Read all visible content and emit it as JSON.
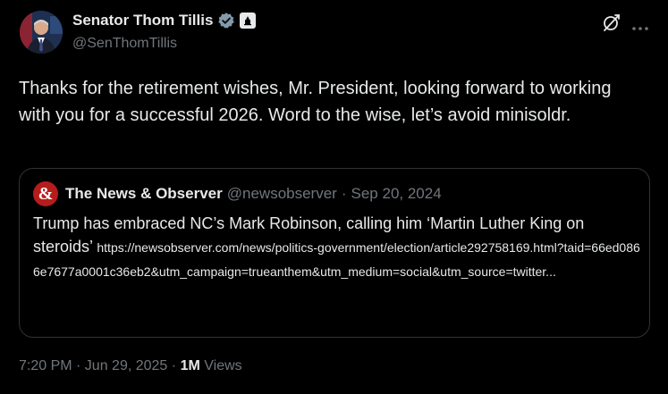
{
  "author": {
    "name": "Senator Thom Tillis",
    "handle": "@SenThomTillis",
    "avatar_icon": "portrait-avatar",
    "verified_icon": "verified-badge-icon",
    "gov_badge_icon": "us-capitol-badge-icon"
  },
  "top_actions": {
    "grok_icon": "grok-icon",
    "more_icon": "more-options-icon"
  },
  "tweet": {
    "text": "Thanks for the retirement wishes, Mr. President, looking forward to working with you for a successful 2026. Word to the wise, let’s avoid minisoldr."
  },
  "quote": {
    "avatar_glyph": "&",
    "name": "The News & Observer",
    "handle": "@newsobserver",
    "separator": "·",
    "date": "Sep 20, 2024",
    "text": "Trump has embraced NC’s Mark Robinson, calling him ‘Martin Luther King on steroids’",
    "link": "https://newsobserver.com/news/politics-government/election/article292758169.html?taid=66ed0866e7677a0001c36eb2&utm_campaign=trueanthem&utm_medium=social&utm_source=twitter..."
  },
  "meta": {
    "time": "7:20 PM · Jun 29, 2025",
    "separator": "·",
    "views_count": "1M",
    "views_label": "Views"
  },
  "colors": {
    "background": "#000000",
    "text_primary": "#e7e9ea",
    "text_secondary": "#71767b",
    "verified": "#829aab",
    "border": "#2f3336",
    "quote_avatar": "#b71c1c"
  }
}
